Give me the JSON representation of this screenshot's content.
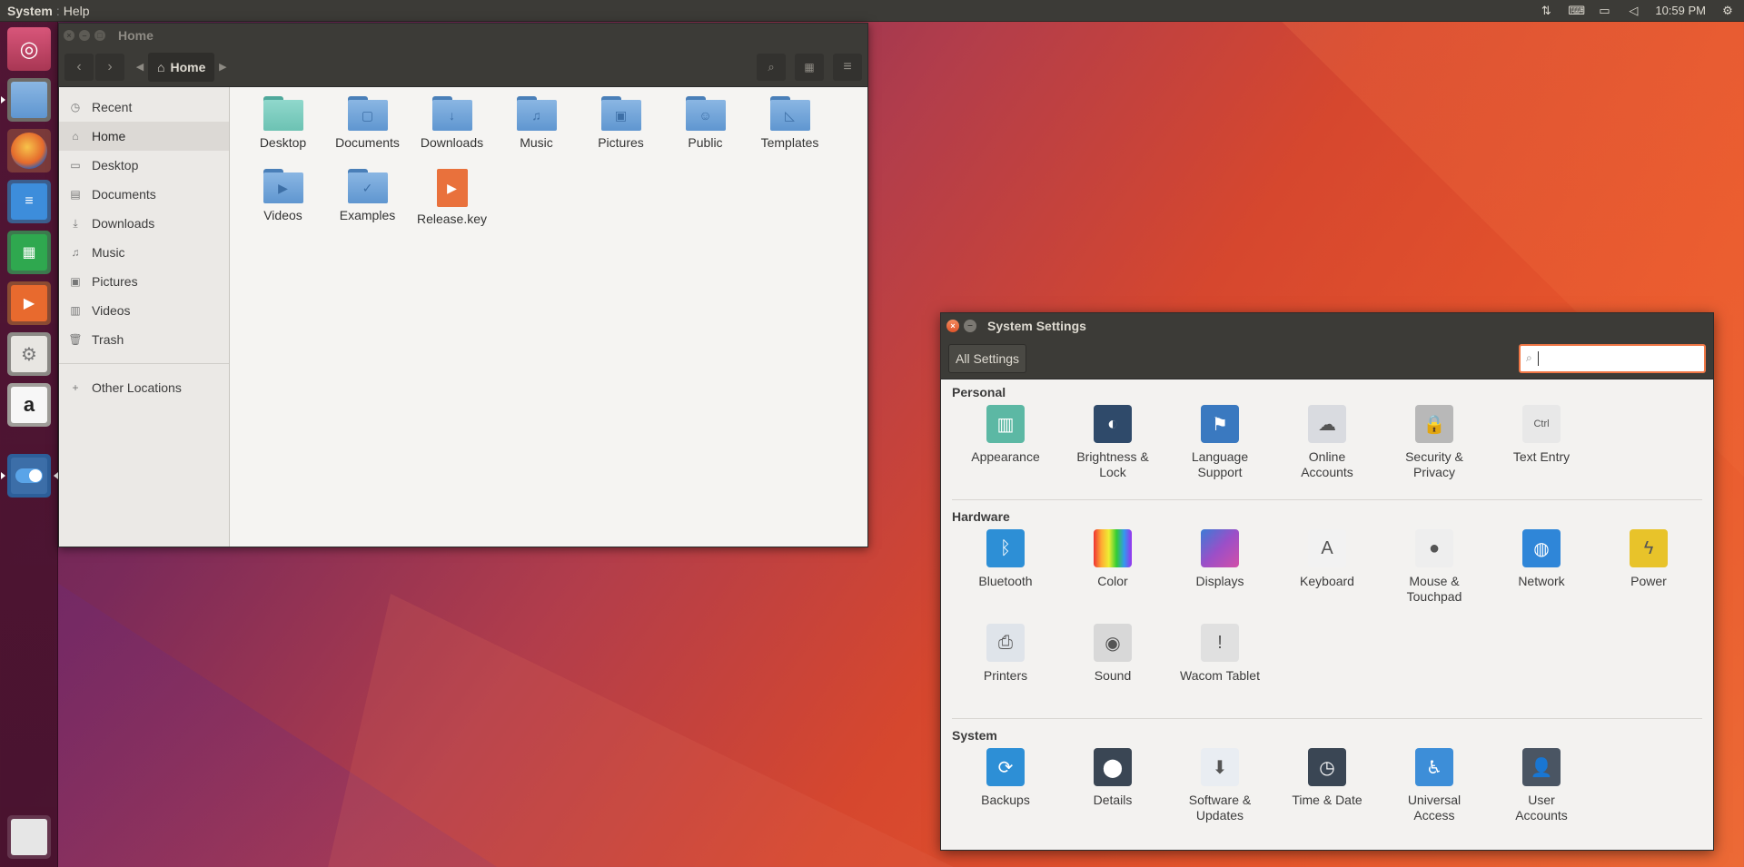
{
  "top_panel": {
    "app_menu": "System",
    "help_menu": "Help",
    "clock": "10:59 PM",
    "indicators": [
      "network-icon",
      "keyboard-icon",
      "battery-icon",
      "volume-icon",
      "settings-icon"
    ]
  },
  "launcher": {
    "items": [
      {
        "name": "ubuntu-logo-icon",
        "color": "#c34e6a"
      },
      {
        "name": "files-app-icon",
        "color": "#6aa0d8"
      },
      {
        "name": "firefox-icon",
        "color": "#e4692c"
      },
      {
        "name": "writer-icon",
        "color": "#3d8ddb"
      },
      {
        "name": "calc-icon",
        "color": "#2fa84f"
      },
      {
        "name": "impress-icon",
        "color": "#e86a2e"
      },
      {
        "name": "software-center-icon",
        "color": "#e8e6e2"
      },
      {
        "name": "amazon-icon",
        "color": "#f2f2f2"
      },
      {
        "name": "system-settings-icon",
        "color": "#3c6ea8"
      }
    ],
    "trash_icon": "trash-icon"
  },
  "files": {
    "window_title": "Home",
    "crumb": "Home",
    "sidebar": [
      {
        "label": "Recent",
        "icon": "◷"
      },
      {
        "label": "Home",
        "icon": "⌂",
        "active": true
      },
      {
        "label": "Desktop",
        "icon": "▭"
      },
      {
        "label": "Documents",
        "icon": "▤"
      },
      {
        "label": "Downloads",
        "icon": "⤓"
      },
      {
        "label": "Music",
        "icon": "♫"
      },
      {
        "label": "Pictures",
        "icon": "▣"
      },
      {
        "label": "Videos",
        "icon": "▥"
      },
      {
        "label": "Trash",
        "icon": "🗑"
      }
    ],
    "other_locations": "Other Locations",
    "items": [
      {
        "label": "Desktop",
        "glyph": ""
      },
      {
        "label": "Documents",
        "glyph": "▢"
      },
      {
        "label": "Downloads",
        "glyph": "↓"
      },
      {
        "label": "Music",
        "glyph": "♫"
      },
      {
        "label": "Pictures",
        "glyph": "▣"
      },
      {
        "label": "Public",
        "glyph": "☺"
      },
      {
        "label": "Templates",
        "glyph": "◺"
      },
      {
        "label": "Videos",
        "glyph": "▶"
      },
      {
        "label": "Examples",
        "glyph": "✓"
      },
      {
        "label": "Release.key",
        "glyph": "▶"
      }
    ]
  },
  "settings": {
    "window_title": "System Settings",
    "all_settings": "All Settings",
    "search_value": "",
    "sections": [
      {
        "title": "Personal",
        "items": [
          {
            "label": "Appearance",
            "color": "#5cb8a4",
            "glyph": "▥"
          },
          {
            "label": "Brightness &\nLock",
            "color": "#2f4a6a",
            "glyph": "◐"
          },
          {
            "label": "Language\nSupport",
            "color": "#3a79c0",
            "glyph": "⚑"
          },
          {
            "label": "Online\nAccounts",
            "color": "#d9dbe0",
            "glyph": "☁"
          },
          {
            "label": "Security &\nPrivacy",
            "color": "#b8b8b8",
            "glyph": "🔒"
          },
          {
            "label": "Text Entry",
            "color": "#e8e8e8",
            "glyph": "Ctrl"
          }
        ]
      },
      {
        "title": "Hardware",
        "items": [
          {
            "label": "Bluetooth",
            "color": "#2d8fd6",
            "glyph": "ᛒ"
          },
          {
            "label": "Color",
            "color": "#d43f3f",
            "glyph": ""
          },
          {
            "label": "Displays",
            "color": "#6d4fa8",
            "glyph": ""
          },
          {
            "label": "Keyboard",
            "color": "#f2f2f2",
            "glyph": "A"
          },
          {
            "label": "Mouse &\nTouchpad",
            "color": "#eeeeee",
            "glyph": "●"
          },
          {
            "label": "Network",
            "color": "#2f86d8",
            "glyph": "◍"
          },
          {
            "label": "Power",
            "color": "#e8c32a",
            "glyph": "ϟ"
          },
          {
            "label": "Printers",
            "color": "#dfe4ea",
            "glyph": "⎙"
          },
          {
            "label": "Sound",
            "color": "#d8d8d8",
            "glyph": "◉"
          },
          {
            "label": "Wacom Tablet",
            "color": "#e0e0e0",
            "glyph": "!"
          }
        ]
      },
      {
        "title": "System",
        "items": [
          {
            "label": "Backups",
            "color": "#2d8fd6",
            "glyph": "⟳"
          },
          {
            "label": "Details",
            "color": "#3a4654",
            "glyph": "⬤"
          },
          {
            "label": "Software &\nUpdates",
            "color": "#e9edf2",
            "glyph": "⬇"
          },
          {
            "label": "Time & Date",
            "color": "#3a4654",
            "glyph": "◷"
          },
          {
            "label": "Universal\nAccess",
            "color": "#3d8ed8",
            "glyph": "♿"
          },
          {
            "label": "User\nAccounts",
            "color": "#4a5563",
            "glyph": "👤"
          }
        ]
      }
    ]
  }
}
